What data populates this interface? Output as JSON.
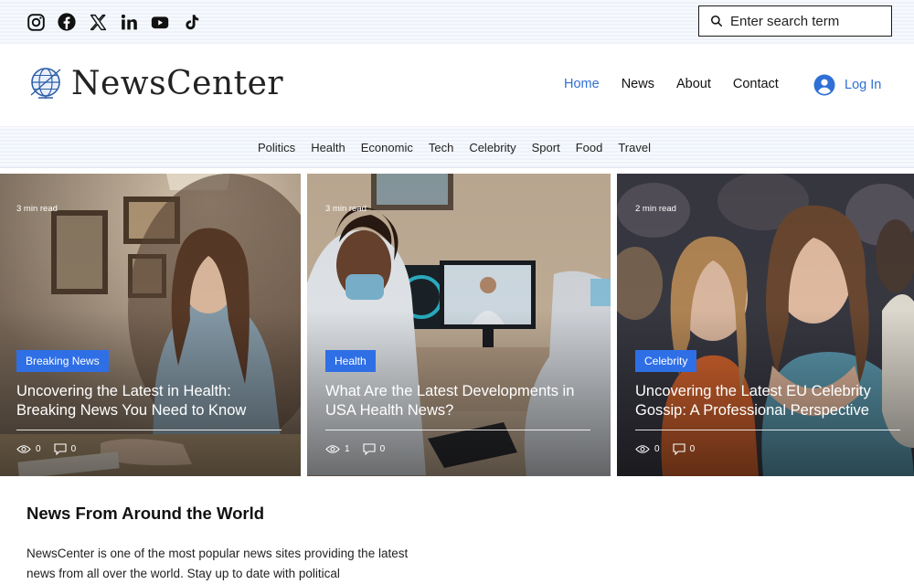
{
  "social": [
    {
      "name": "instagram-icon"
    },
    {
      "name": "facebook-icon"
    },
    {
      "name": "x-icon"
    },
    {
      "name": "linkedin-icon"
    },
    {
      "name": "youtube-icon"
    },
    {
      "name": "tiktok-icon"
    }
  ],
  "search": {
    "placeholder": "Enter search term"
  },
  "brand": {
    "name": "NewsCenter"
  },
  "nav": {
    "home": "Home",
    "news": "News",
    "about": "About",
    "contact": "Contact",
    "login": "Log In"
  },
  "categories": [
    "Politics",
    "Health",
    "Economic",
    "Tech",
    "Celebrity",
    "Sport",
    "Food",
    "Travel"
  ],
  "cards": [
    {
      "read_time": "3 min read",
      "badge": "Breaking News",
      "headline": "Uncovering the Latest in Health: Breaking News You Need to Know",
      "views": "0",
      "comments": "0"
    },
    {
      "read_time": "3 min read",
      "badge": "Health",
      "headline": "What Are the Latest Developments in USA Health News?",
      "views": "1",
      "comments": "0"
    },
    {
      "read_time": "2 min read",
      "badge": "Celebrity",
      "headline": "Uncovering the Latest EU Celebrity Gossip: A Professional Perspective",
      "views": "0",
      "comments": "0"
    }
  ],
  "section": {
    "title": "News From Around the World",
    "body": "NewsCenter is one of the most popular news sites providing the latest news from all over the world. Stay up to date with political"
  },
  "colors": {
    "accent": "#2f6fd6",
    "badge": "#2f6fe6"
  }
}
